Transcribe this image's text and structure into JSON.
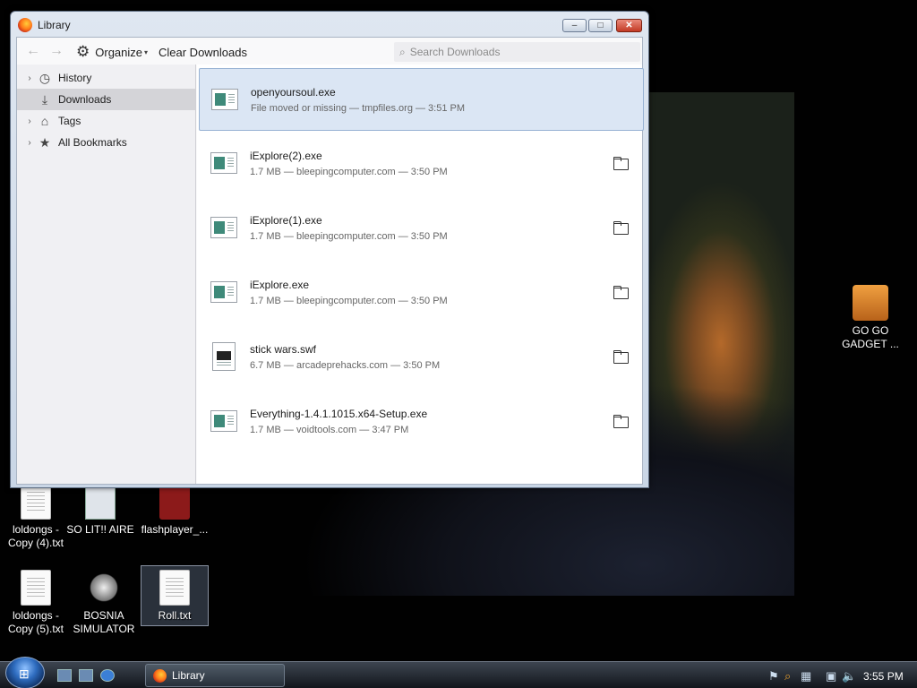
{
  "window": {
    "title": "Library",
    "controls": {
      "minimize": "–",
      "maximize": "□",
      "close": "✕"
    }
  },
  "toolbar": {
    "back_icon": "arrow-left-icon",
    "forward_icon": "arrow-right-icon",
    "organize_label": "Organize",
    "clear_downloads_label": "Clear Downloads",
    "search_placeholder": "Search Downloads"
  },
  "sidebar": {
    "items": [
      {
        "label": "History",
        "icon": "clock-icon",
        "expandable": true
      },
      {
        "label": "Downloads",
        "icon": "download-icon",
        "expandable": false,
        "active": true
      },
      {
        "label": "Tags",
        "icon": "tag-icon",
        "expandable": true
      },
      {
        "label": "All Bookmarks",
        "icon": "star-icon",
        "expandable": true
      }
    ]
  },
  "downloads": [
    {
      "name": "openyoursoul.exe",
      "status": "File moved or missing — tmpfiles.org — 3:51 PM",
      "selected": true,
      "folder": false
    },
    {
      "name": "iExplore(2).exe",
      "status": "1.7 MB — bleepingcomputer.com — 3:50 PM",
      "folder": true
    },
    {
      "name": "iExplore(1).exe",
      "status": "1.7 MB — bleepingcomputer.com — 3:50 PM",
      "folder": true
    },
    {
      "name": "iExplore.exe",
      "status": "1.7 MB — bleepingcomputer.com — 3:50 PM",
      "folder": true
    },
    {
      "name": "stick wars.swf",
      "status": "6.7 MB — arcadeprehacks.com — 3:50 PM",
      "folder": true,
      "type": "swf"
    },
    {
      "name": "Everything-1.4.1.1015.x64-Setup.exe",
      "status": "1.7 MB — voidtools.com — 3:47 PM",
      "folder": true
    }
  ],
  "desktop": {
    "icons": [
      {
        "label": "loldongs - Copy (4).txt",
        "icon": "text-file-icon"
      },
      {
        "label": "SO LIT!! AIRE",
        "icon": "shortcut-icon"
      },
      {
        "label": "flashplayer_...",
        "icon": "flash-icon"
      },
      {
        "label": "loldongs - Copy (5).txt",
        "icon": "text-file-icon"
      },
      {
        "label": "BOSNIA SIMULATOR",
        "icon": "mine-icon"
      },
      {
        "label": "Roll.txt",
        "icon": "text-file-icon",
        "selected": true
      },
      {
        "label": "GO GO GADGET ...",
        "icon": "briefcase-icon"
      }
    ]
  },
  "taskbar": {
    "start_icon": "windows-logo-icon",
    "task_label": "Library",
    "clock": "3:55 PM"
  }
}
